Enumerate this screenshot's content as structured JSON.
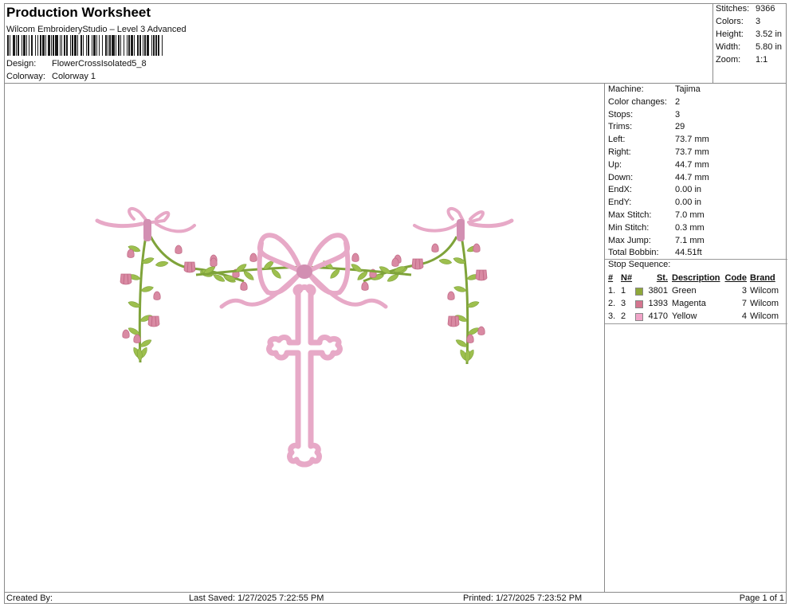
{
  "header": {
    "title": "Production Worksheet",
    "subtitle": "Wilcom EmbroideryStudio – Level 3 Advanced",
    "design_label": "Design:",
    "design_value": "FlowerCrossIsolated5_8",
    "colorway_label": "Colorway:",
    "colorway_value": "Colorway 1"
  },
  "summary": {
    "stitches_label": "Stitches:",
    "stitches_value": "9366",
    "colors_label": "Colors:",
    "colors_value": "3",
    "height_label": "Height:",
    "height_value": "3.52 in",
    "width_label": "Width:",
    "width_value": "5.80 in",
    "zoom_label": "Zoom:",
    "zoom_value": "1:1"
  },
  "info": {
    "rows": [
      {
        "label": "Machine:",
        "value": "Tajima"
      },
      {
        "label": "Color changes:",
        "value": "2"
      },
      {
        "label": "Stops:",
        "value": "3"
      },
      {
        "label": "Trims:",
        "value": "29"
      },
      {
        "label": "Left:",
        "value": "73.7 mm"
      },
      {
        "label": "Right:",
        "value": "73.7 mm"
      },
      {
        "label": "Up:",
        "value": "44.7 mm"
      },
      {
        "label": "Down:",
        "value": "44.7 mm"
      },
      {
        "label": "EndX:",
        "value": "0.00 in"
      },
      {
        "label": "EndY:",
        "value": "0.00 in"
      },
      {
        "label": "Max Stitch:",
        "value": "7.0 mm"
      },
      {
        "label": "Min Stitch:",
        "value": "0.3 mm"
      },
      {
        "label": "Max Jump:",
        "value": "7.1 mm"
      },
      {
        "label": "Total Bobbin:",
        "value": "44.51ft"
      }
    ],
    "stop_sequence_title": "Stop Sequence:",
    "columns": {
      "num": "#",
      "n": "N#",
      "st": "St.",
      "desc": "Description",
      "code": "Code",
      "brand": "Brand"
    },
    "stops": [
      {
        "num": "1.",
        "n": "1",
        "color": "#8fa83a",
        "st": "3801",
        "desc": "Green",
        "code": "3",
        "brand": "Wilcom"
      },
      {
        "num": "2.",
        "n": "3",
        "color": "#d4758f",
        "st": "1393",
        "desc": "Magenta",
        "code": "7",
        "brand": "Wilcom"
      },
      {
        "num": "3.",
        "n": "2",
        "color": "#f0a4c8",
        "st": "4170",
        "desc": "Yellow",
        "code": "4",
        "brand": "Wilcom"
      }
    ]
  },
  "design_colors": {
    "leaf": "#9dbf4e",
    "leaf_dark": "#7fa33a",
    "flower": "#d98aa3",
    "flower_dark": "#c26c88",
    "ribbon": "#e7a9c7",
    "ribbon_dark": "#d28fb2"
  },
  "footer": {
    "created_by": "Created By:",
    "last_saved": "Last Saved: 1/27/2025 7:22:55 PM",
    "printed": "Printed: 1/27/2025 7:23:52 PM",
    "page": "Page 1 of 1"
  }
}
